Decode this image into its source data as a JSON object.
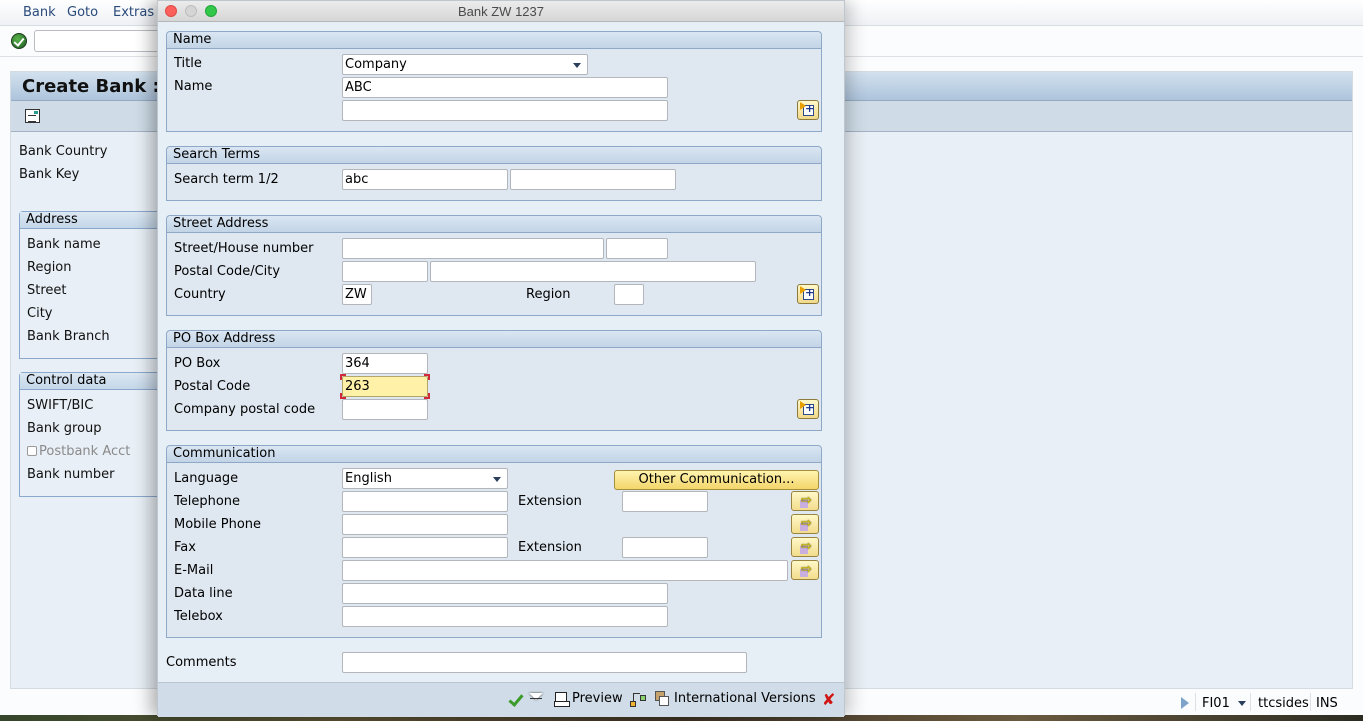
{
  "main_window": {
    "menu": [
      "Bank",
      "Goto",
      "Extras"
    ],
    "command_field": {
      "value": ""
    },
    "title": "Create Bank : D",
    "top_labels": [
      "Bank Country",
      "Bank Key"
    ],
    "address_group": {
      "header": "Address",
      "labels": [
        "Bank name",
        "Region",
        "Street",
        "City",
        "Bank Branch"
      ]
    },
    "control_group": {
      "header": "Control data",
      "labels": [
        "SWIFT/BIC",
        "Bank group"
      ],
      "postbank_checkbox": {
        "label": "Postbank Acct",
        "checked": false,
        "disabled": true
      },
      "last_label": "Bank number"
    }
  },
  "dialog": {
    "title": "Bank ZW 1237",
    "name_group": {
      "header": "Name",
      "title_label": "Title",
      "title_value": "Company",
      "name_label": "Name",
      "name_value": "ABC",
      "name2_value": ""
    },
    "search_group": {
      "header": "Search Terms",
      "label": "Search term 1/2",
      "term1": "abc",
      "term2": ""
    },
    "street_group": {
      "header": "Street Address",
      "street_label": "Street/House number",
      "street_value": "",
      "house_value": "",
      "postal_city_label": "Postal Code/City",
      "postal_value": "",
      "city_value": "",
      "country_label": "Country",
      "country_value": "ZW",
      "region_label": "Region",
      "region_value": ""
    },
    "pobox_group": {
      "header": "PO Box Address",
      "pobox_label": "PO Box",
      "pobox_value": "364",
      "postal_label": "Postal Code",
      "postal_value": "263",
      "company_postal_label": "Company postal code",
      "company_postal_value": ""
    },
    "comm_group": {
      "header": "Communication",
      "language_label": "Language",
      "language_value": "English",
      "other_button": "Other Communication...",
      "telephone_label": "Telephone",
      "telephone_value": "",
      "extension_label": "Extension",
      "tel_extension_value": "",
      "mobile_label": "Mobile Phone",
      "mobile_value": "",
      "fax_label": "Fax",
      "fax_value": "",
      "fax_extension_value": "",
      "email_label": "E-Mail",
      "email_value": "",
      "dataline_label": "Data line",
      "dataline_value": "",
      "telebox_label": "Telebox",
      "telebox_value": ""
    },
    "comments_label": "Comments",
    "comments_value": "",
    "footer": {
      "preview": "Preview",
      "international": "International Versions"
    }
  },
  "status_bar": {
    "transaction": "FI01",
    "server": "ttcsides",
    "mode": "INS"
  }
}
